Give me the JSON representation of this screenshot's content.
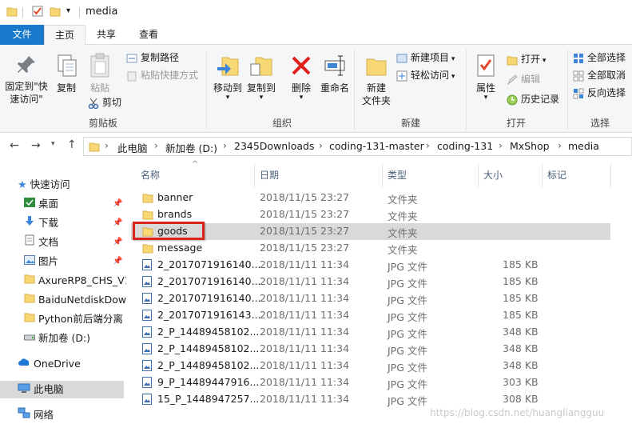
{
  "window": {
    "title": "media"
  },
  "tabs": {
    "file": "文件",
    "home": "主页",
    "share": "共享",
    "view": "查看"
  },
  "ribbon": {
    "clipboard": {
      "label": "剪贴板",
      "pin_quick": "固定到\"快速访问\"",
      "copy": "复制",
      "paste": "粘贴",
      "copy_path": "复制路径",
      "paste_shortcut": "粘贴快捷方式",
      "cut": "剪切"
    },
    "organize": {
      "label": "组织",
      "move_to": "移动到",
      "copy_to": "复制到",
      "delete": "删除",
      "rename": "重命名"
    },
    "new": {
      "label": "新建",
      "new_folder": "新建\n文件夹",
      "new_item": "新建项目",
      "easy_access": "轻松访问"
    },
    "open": {
      "label": "打开",
      "properties": "属性",
      "open": "打开",
      "edit": "编辑",
      "history": "历史记录"
    },
    "select": {
      "label": "选择",
      "select_all": "全部选择",
      "select_none": "全部取消",
      "invert": "反向选择"
    }
  },
  "address": {
    "crumbs": [
      "此电脑",
      "新加卷 (D:)",
      "2345Downloads",
      "coding-131-master",
      "coding-131",
      "MxShop",
      "media"
    ]
  },
  "nav": {
    "quick_access": "快速访问",
    "desktop": "桌面",
    "downloads": "下载",
    "documents": "文档",
    "pictures": "图片",
    "folder1": "AxureRP8_CHS_V1",
    "folder2": "BaiduNetdiskDow",
    "folder3": "Python前后端分离",
    "drive_d": "新加卷 (D:)",
    "onedrive": "OneDrive",
    "this_pc": "此电脑",
    "network": "网络"
  },
  "columns": {
    "name": "名称",
    "date": "日期",
    "type": "类型",
    "size": "大小",
    "tags": "标记"
  },
  "files": [
    {
      "name": "banner",
      "date": "2018/11/15 23:27",
      "type": "文件夹",
      "size": "",
      "kind": "folder"
    },
    {
      "name": "brands",
      "date": "2018/11/15 23:27",
      "type": "文件夹",
      "size": "",
      "kind": "folder"
    },
    {
      "name": "goods",
      "date": "2018/11/15 23:27",
      "type": "文件夹",
      "size": "",
      "kind": "folder",
      "selected": true
    },
    {
      "name": "message",
      "date": "2018/11/15 23:27",
      "type": "文件夹",
      "size": "",
      "kind": "folder"
    },
    {
      "name": "2_2017071916140...",
      "date": "2018/11/11 11:34",
      "type": "JPG 文件",
      "size": "185 KB",
      "kind": "jpg"
    },
    {
      "name": "2_2017071916140...",
      "date": "2018/11/11 11:34",
      "type": "JPG 文件",
      "size": "185 KB",
      "kind": "jpg"
    },
    {
      "name": "2_2017071916140...",
      "date": "2018/11/11 11:34",
      "type": "JPG 文件",
      "size": "185 KB",
      "kind": "jpg"
    },
    {
      "name": "2_2017071916143...",
      "date": "2018/11/11 11:34",
      "type": "JPG 文件",
      "size": "185 KB",
      "kind": "jpg"
    },
    {
      "name": "2_P_14489458102...",
      "date": "2018/11/11 11:34",
      "type": "JPG 文件",
      "size": "348 KB",
      "kind": "jpg"
    },
    {
      "name": "2_P_14489458102...",
      "date": "2018/11/11 11:34",
      "type": "JPG 文件",
      "size": "348 KB",
      "kind": "jpg"
    },
    {
      "name": "2_P_14489458102...",
      "date": "2018/11/11 11:34",
      "type": "JPG 文件",
      "size": "348 KB",
      "kind": "jpg"
    },
    {
      "name": "9_P_14489447916...",
      "date": "2018/11/11 11:34",
      "type": "JPG 文件",
      "size": "303 KB",
      "kind": "jpg"
    },
    {
      "name": "15_P_1448947257...",
      "date": "2018/11/11 11:34",
      "type": "JPG 文件",
      "size": "308 KB",
      "kind": "jpg"
    }
  ],
  "watermark": "https://blog.csdn.net/huangliangguu",
  "colors": {
    "accent": "#1979ca",
    "folder": "#f8d775",
    "highlight": "#d9261c",
    "delete": "#e0201b"
  }
}
